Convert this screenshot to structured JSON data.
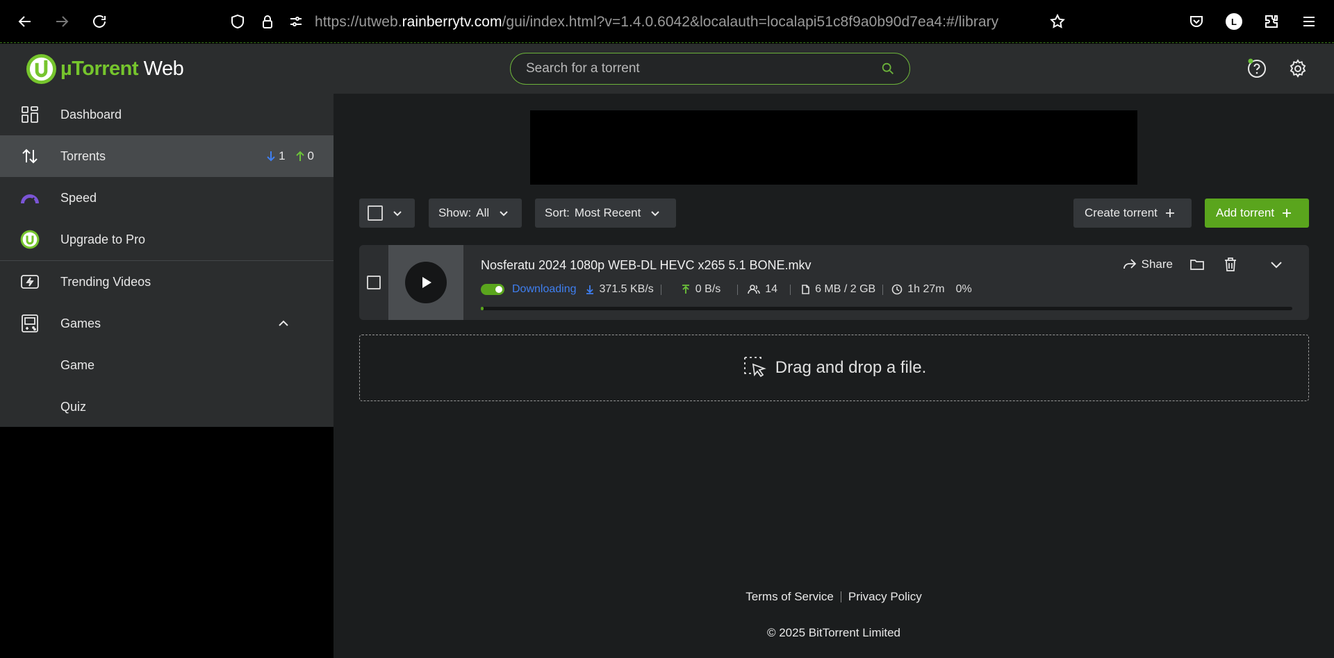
{
  "browser": {
    "url_prefix": "https://utweb.",
    "url_host": "rainberrytv.com",
    "url_suffix": "/gui/index.html?v=1.4.0.6042&localauth=localapi51c8f9a0b90d7ea4:#/library",
    "profile_initial": "L"
  },
  "header": {
    "logo_mu": "µTorrent",
    "logo_web": " Web",
    "search_placeholder": "Search for a torrent"
  },
  "sidebar": {
    "items": [
      {
        "label": "Dashboard"
      },
      {
        "label": "Torrents",
        "down_count": "1",
        "up_count": "0"
      },
      {
        "label": "Speed"
      },
      {
        "label": "Upgrade to Pro"
      },
      {
        "label": "Trending Videos"
      },
      {
        "label": "Games"
      },
      {
        "label": "Game"
      },
      {
        "label": "Quiz"
      }
    ]
  },
  "toolbar": {
    "show_label": "Show:",
    "show_value": "All",
    "sort_label": "Sort:",
    "sort_value": "Most Recent",
    "create_label": "Create torrent",
    "add_label": "Add torrent"
  },
  "torrent": {
    "name": "Nosferatu 2024 1080p WEB-DL HEVC x265 5.1 BONE.mkv",
    "status": "Downloading",
    "down_speed": "371.5 KB/s",
    "up_speed": "0 B/s",
    "peers": "14",
    "size": "6 MB / 2 GB",
    "eta": "1h 27m",
    "percent": "0%",
    "progress": 0.003,
    "share_label": "Share"
  },
  "dropzone": {
    "text": "Drag and drop a file."
  },
  "footer": {
    "terms": "Terms of Service",
    "privacy": "Privacy Policy",
    "copyright": "© 2025 BitTorrent Limited"
  },
  "colors": {
    "accent_green": "#5aa51d",
    "download_blue": "#3f7ff0",
    "speed_purple": "#7b55d6"
  }
}
